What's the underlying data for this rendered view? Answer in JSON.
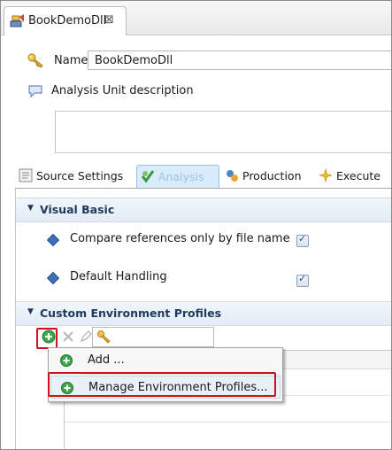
{
  "editor": {
    "tab_title": "BookDemoDll",
    "close_glyph": "⊠"
  },
  "form": {
    "name_label": "Name",
    "name_value": "BookDemoDll",
    "description_label": "Analysis Unit description",
    "description_value": ""
  },
  "section_tabs": [
    {
      "label": "Source Settings",
      "icon": "source-settings-icon"
    },
    {
      "label": "Analysis",
      "icon": "analysis-icon",
      "active": true
    },
    {
      "label": "Production",
      "icon": "production-icon"
    },
    {
      "label": "Execute",
      "icon": "execute-icon"
    }
  ],
  "visual_basic": {
    "title": "Visual Basic",
    "options": [
      {
        "label": "Compare references only by file name",
        "checked": true
      },
      {
        "label": "Default Handling",
        "checked": true
      }
    ]
  },
  "custom_env": {
    "title": "Custom Environment Profiles",
    "toolbar": [
      "add-icon",
      "delete-icon",
      "edit-icon",
      "key-icon"
    ]
  },
  "context_menu": {
    "items": [
      {
        "label": "Add ..."
      },
      {
        "label": "Manage Environment Profiles..."
      }
    ]
  },
  "colors": {
    "highlight_red": "#d0101a",
    "active_tab_bg": "#d8ecfb",
    "section_header": "#1f3a5c",
    "add_green": "#3da54a"
  }
}
